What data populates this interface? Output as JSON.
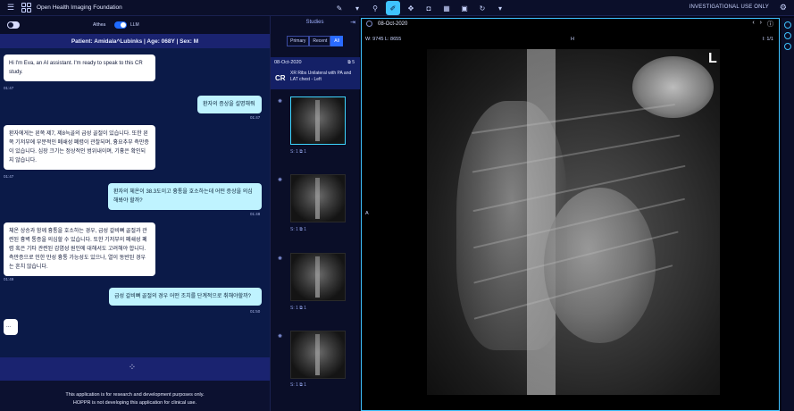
{
  "topbar": {
    "brand": "Open Health Imaging Foundation",
    "investigational": "INVESTIGATIONAL USE ONLY",
    "tools": [
      "pencil-icon",
      "chevron-down-icon",
      "search-icon",
      "paint-brush-icon",
      "move-icon",
      "camera-icon",
      "layout-icon",
      "layers-icon",
      "refresh-icon",
      "chevron-down-icon"
    ]
  },
  "chat": {
    "toggle_left": "Althea",
    "toggle_right": "LLM",
    "patient": "Patient: Amidala^Lubinks | Age: 068Y | Sex: M",
    "messages": [
      {
        "from": "assistant",
        "text": "Hi I'm Eva, an AI assistant. I'm ready to speak to this CR study.",
        "time": "01:47"
      },
      {
        "from": "user",
        "text": "환자의 증상을 설명해줘",
        "time": "01:47"
      },
      {
        "from": "assistant",
        "text": "환자에게는 왼쪽 제7, 제8늑골의 급성 골절이 있습니다. 또한 왼쪽 기저부에 부분적인 폐쇄성 폐렴이 관찰되며, 흉요추부 측만증이 있습니다. 심장 크기는 정상적인 범위내이며, 기흉은 확인되지 않습니다.",
        "time": "01:47"
      },
      {
        "from": "user",
        "text": "환자의 체온이 38.3도이고 흉통을 호소하는데 어떤 증상을 의심해봐야 할까?",
        "time": "01:48"
      },
      {
        "from": "assistant",
        "text": "체온 상승과 함께 흉통을 호소하는 경우, 급성 갈비뼈 골절과 관련된 흉벽 통증을 의심할 수 있습니다. 또한 기저부의 폐쇄성 폐렴 혹은 기타 관련된 감염성 원인에 대해서도 고려해야 합니다. 측만증으로 인한 만성 흉통 가능성도 있으나, 열이 동반된 경우는 흔치 않습니다.",
        "time": "01:49"
      },
      {
        "from": "user",
        "text": "급성 갈비뼈 골절의 경우 어떤 조치를 단계적으로 취해야할까?",
        "time": "01:50"
      },
      {
        "from": "assistant",
        "text": "...",
        "time": ""
      }
    ],
    "footer_line1": "This application is for research and development purposes only.",
    "footer_line2": "HOPPR is not developing this application for clinical use."
  },
  "studies": {
    "title": "Studies",
    "tabs": [
      "Primary",
      "Recent",
      "All"
    ],
    "active_tab": "All",
    "date": "08-Oct-2020",
    "count": "5",
    "modality": "CR",
    "description": "XR Ribs Unilateral with PA and LAT chest - Left",
    "thumbnails": [
      {
        "meta_s": "S: 1",
        "meta_n": "1"
      },
      {
        "meta_s": "S: 1",
        "meta_n": "1"
      },
      {
        "meta_s": "S: 1",
        "meta_n": "1"
      },
      {
        "meta_s": "S: 1",
        "meta_n": "1"
      }
    ]
  },
  "viewer": {
    "date": "08-Oct-2020",
    "wl": "W: 9745  L: 8655",
    "top_marker": "H",
    "left_marker": "A",
    "image_index": "I: 1/1",
    "lat_marker": "L"
  }
}
